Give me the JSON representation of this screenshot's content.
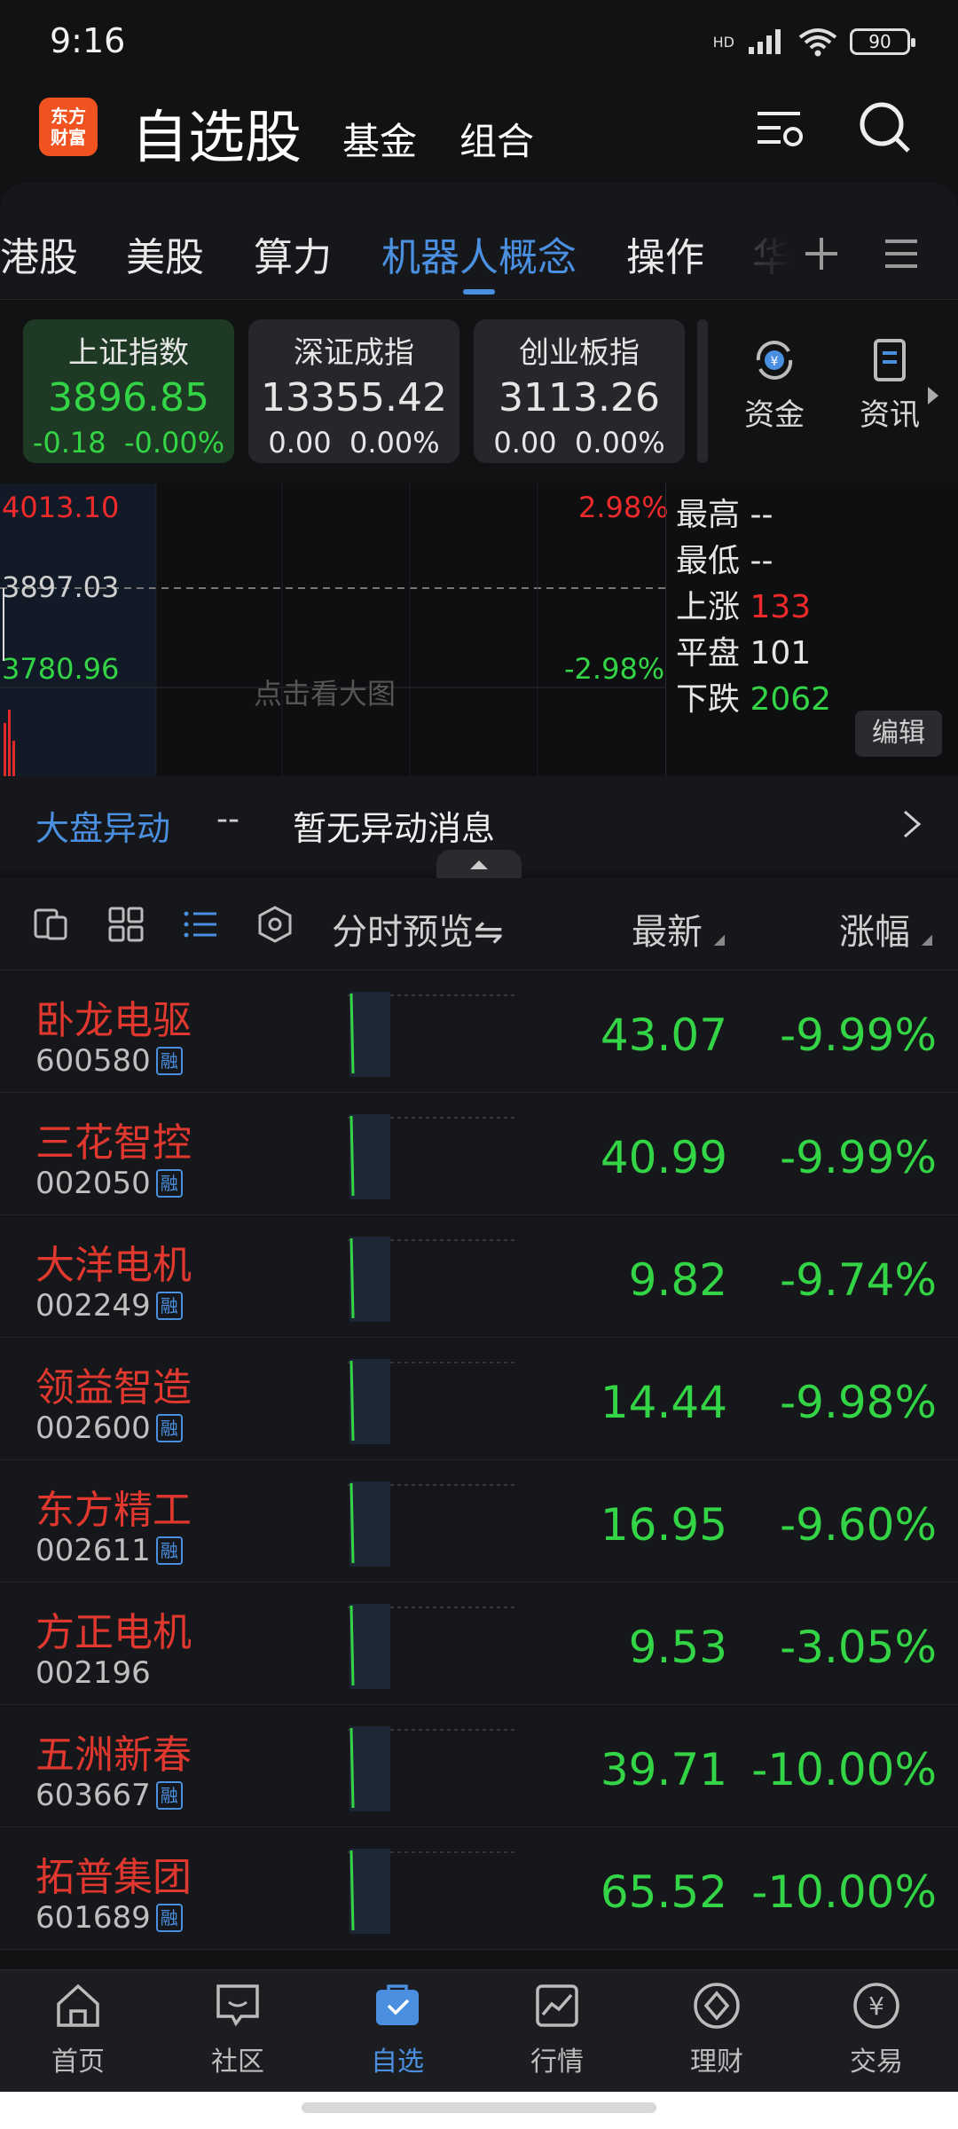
{
  "status": {
    "time": "9:16",
    "battery": "90",
    "hd_badge": "HD"
  },
  "header": {
    "logo_line1": "东方",
    "logo_line2": "财富",
    "title": "自选股",
    "tabs": [
      "基金",
      "组合"
    ],
    "icons": [
      "settings-filter-icon",
      "search-icon"
    ]
  },
  "subtabs": {
    "items": [
      "港股",
      "美股",
      "算力",
      "机器人概念",
      "操作",
      "华"
    ],
    "active_index": 3
  },
  "indices": [
    {
      "name": "上证指数",
      "value": "3896.85",
      "change": "-0.18",
      "pct": "-0.00%"
    },
    {
      "name": "深证成指",
      "value": "13355.42",
      "change": "0.00",
      "pct": "0.00%"
    },
    {
      "name": "创业板指",
      "value": "3113.26",
      "change": "0.00",
      "pct": "0.00%"
    }
  ],
  "quick_links": [
    {
      "label": "资金",
      "icon": "yuan-cycle-icon"
    },
    {
      "label": "资讯",
      "icon": "document-icon"
    }
  ],
  "chart": {
    "high_label": "4013.10",
    "mid_label": "3897.03",
    "low_label": "3780.96",
    "high_pct": "2.98%",
    "low_pct": "-2.98%",
    "watermark": "点击看大图"
  },
  "stats": {
    "high_label": "最高",
    "high_value": "--",
    "low_label": "最低",
    "low_value": "--",
    "up_label": "上涨",
    "up_value": "133",
    "flat_label": "平盘",
    "flat_value": "101",
    "down_label": "下跌",
    "down_value": "2062",
    "edit_label": "编辑"
  },
  "alert": {
    "title": "大盘异动",
    "dash": "--",
    "message": "暂无异动消息"
  },
  "list_header": {
    "preview": "分时预览⇋",
    "latest": "最新",
    "change": "涨幅"
  },
  "stocks": [
    {
      "name": "卧龙电驱",
      "code": "600580",
      "rong": true,
      "price": "43.07",
      "pct": "-9.99%"
    },
    {
      "name": "三花智控",
      "code": "002050",
      "rong": true,
      "price": "40.99",
      "pct": "-9.99%"
    },
    {
      "name": "大洋电机",
      "code": "002249",
      "rong": true,
      "price": "9.82",
      "pct": "-9.74%"
    },
    {
      "name": "领益智造",
      "code": "002600",
      "rong": true,
      "price": "14.44",
      "pct": "-9.98%"
    },
    {
      "name": "东方精工",
      "code": "002611",
      "rong": true,
      "price": "16.95",
      "pct": "-9.60%"
    },
    {
      "name": "方正电机",
      "code": "002196",
      "rong": false,
      "price": "9.53",
      "pct": "-3.05%"
    },
    {
      "name": "五洲新春",
      "code": "603667",
      "rong": true,
      "price": "39.71",
      "pct": "-10.00%"
    },
    {
      "name": "拓普集团",
      "code": "601689",
      "rong": true,
      "price": "65.52",
      "pct": "-10.00%"
    }
  ],
  "rong_label": "融",
  "bottom_nav": [
    {
      "label": "首页",
      "icon": "home-icon"
    },
    {
      "label": "社区",
      "icon": "chat-icon"
    },
    {
      "label": "自选",
      "icon": "favorites-icon",
      "active": true
    },
    {
      "label": "行情",
      "icon": "market-chart-icon"
    },
    {
      "label": "理财",
      "icon": "diamond-icon"
    },
    {
      "label": "交易",
      "icon": "yuan-circle-icon"
    }
  ]
}
